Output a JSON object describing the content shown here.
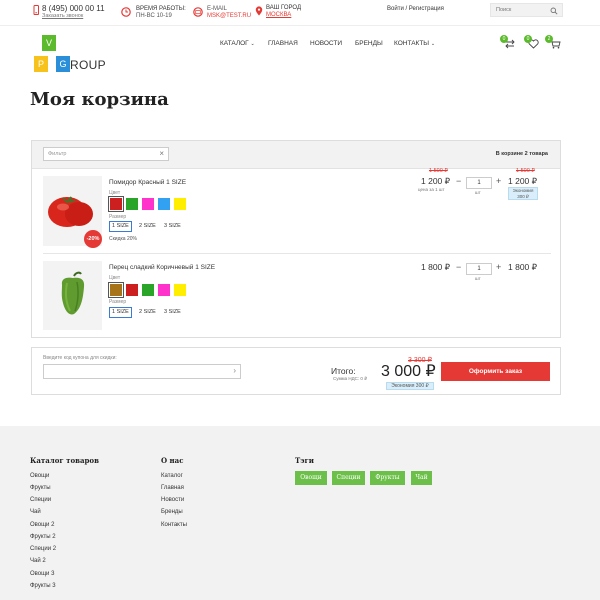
{
  "topbar": {
    "phone": "8 (495) 000 00 11",
    "callback": "Заказать звонок",
    "hours_title": "ВРЕМЯ РАБОТЫ:",
    "hours_value": "ПН-ВС 10-19",
    "email_title": "E-MAIL",
    "email_value": "MSK@TEST.RU",
    "city_title": "ВАШ ГОРОД",
    "city_value": "МОСКВА",
    "login": "Войти / Регистрация",
    "search_placeholder": "Поиск"
  },
  "logo": {
    "letters": [
      "V",
      "P",
      "G"
    ],
    "rest": "ROUP",
    "colors": {
      "v": "#5bbb2c",
      "p": "#f6c21b",
      "g": "#2a8fd8"
    }
  },
  "nav": [
    {
      "label": "КАТАЛОГ",
      "has_dropdown": true
    },
    {
      "label": "ГЛАВНАЯ",
      "has_dropdown": false
    },
    {
      "label": "НОВОСТИ",
      "has_dropdown": false
    },
    {
      "label": "БРЕНДЫ",
      "has_dropdown": false
    },
    {
      "label": "КОНТАКТЫ",
      "has_dropdown": true
    }
  ],
  "header_badges": {
    "compare": "0",
    "favorites": "0",
    "cart": "2"
  },
  "page_title": "Моя корзина",
  "cart": {
    "filter_placeholder": "Фильтр",
    "count_text": "В корзине 2 товара",
    "items": [
      {
        "name": "Помидор Красный 1 SIZE",
        "color_label": "Цвет",
        "colors": [
          "#cc1f1f",
          "#2aa52a",
          "#ff33cc",
          "#33a1f2",
          "#ffee00"
        ],
        "selected_color": 0,
        "size_label": "Размер",
        "sizes": [
          "1 SIZE",
          "2 SIZE",
          "3 SIZE"
        ],
        "selected_size": 0,
        "discount_badge": "-20%",
        "discount_text": "Скидка 20%",
        "old_price": "1 500 ₽",
        "price": "1 200 ₽",
        "price_sub": "цена за 1 шт",
        "qty": "1",
        "unit": "шт",
        "sum_old": "1 500 ₽",
        "sum": "1 200 ₽",
        "economy": "Экономия 300 ₽"
      },
      {
        "name": "Перец сладкий Коричневый 1 SIZE",
        "color_label": "Цвет",
        "colors": [
          "#a8741a",
          "#cc1f1f",
          "#2aa52a",
          "#ff33cc",
          "#ffee00"
        ],
        "selected_color": 0,
        "size_label": "Размер",
        "sizes": [
          "1 SIZE",
          "2 SIZE",
          "3 SIZE"
        ],
        "selected_size": 0,
        "price": "1 800 ₽",
        "qty": "1",
        "unit": "шт",
        "sum": "1 800 ₽"
      }
    ]
  },
  "coupon": {
    "label": "Введите код купона для скидки:"
  },
  "totals": {
    "label": "Итого:",
    "vat": "Сумма НДС: 0 ₽",
    "old": "3 300 ₽",
    "total": "3 000 ₽",
    "economy": "Экономия 300 ₽",
    "order_button": "Оформить заказ"
  },
  "footer": {
    "catalog": {
      "title": "Каталог товаров",
      "links": [
        "Овощи",
        "Фрукты",
        "Специи",
        "Чай",
        "Овощи 2",
        "Фрукты 2",
        "Специи 2",
        "Чай 2",
        "Овощи 3",
        "Фрукты 3"
      ]
    },
    "about": {
      "title": "О нас",
      "links": [
        "Каталог",
        "Главная",
        "Новости",
        "Бренды",
        "Контакты"
      ]
    },
    "tags": {
      "title": "Тэги",
      "items": [
        "Овощи",
        "Специи",
        "Фрукты",
        "Чай"
      ]
    }
  }
}
